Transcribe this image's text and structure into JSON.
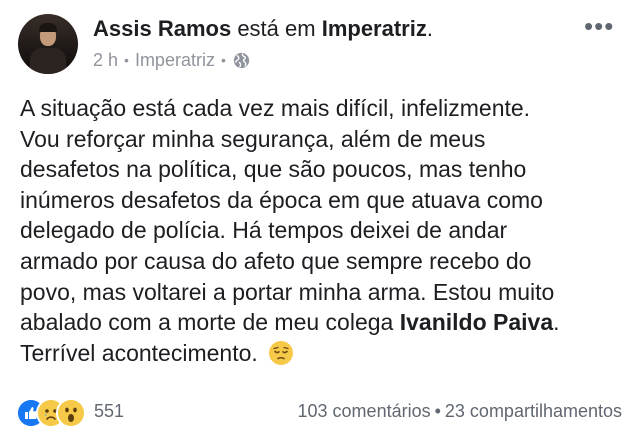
{
  "post": {
    "author": "Assis Ramos",
    "connector": "está em",
    "place": "Imperatriz",
    "header_end": ".",
    "time": "2 h",
    "location_meta": "Imperatriz",
    "privacy_icon": "globe-icon",
    "more_icon": "more-options-icon",
    "text_lines": [
      "A situação está cada vez mais difícil, infelizmente.",
      "Vou reforçar minha segurança, além de meus",
      "desafetos na política, que são poucos, mas tenho",
      "inúmeros desafetos da época em que atuava como",
      "delegado de polícia. Há tempos deixei de andar",
      "armado por causa do afeto que sempre recebo do",
      "povo, mas voltarei a portar minha arma. Estou muito"
    ],
    "line8_prefix": "abalado com a morte de meu colega ",
    "mention": "Ivanildo Paiva",
    "line8_suffix": ".",
    "last_line": "Terrível acontecimento.",
    "emoji": "pensive-face"
  },
  "footer": {
    "reactions": [
      "like",
      "sad",
      "wow"
    ],
    "reaction_count": "551",
    "comments": "103 comentários",
    "separator": "•",
    "shares": "23 compartilhamentos"
  },
  "colors": {
    "text": "#1c1e21",
    "meta": "#90949c",
    "like_blue": "#1877f2",
    "emoji_yellow": "#f7c948"
  }
}
